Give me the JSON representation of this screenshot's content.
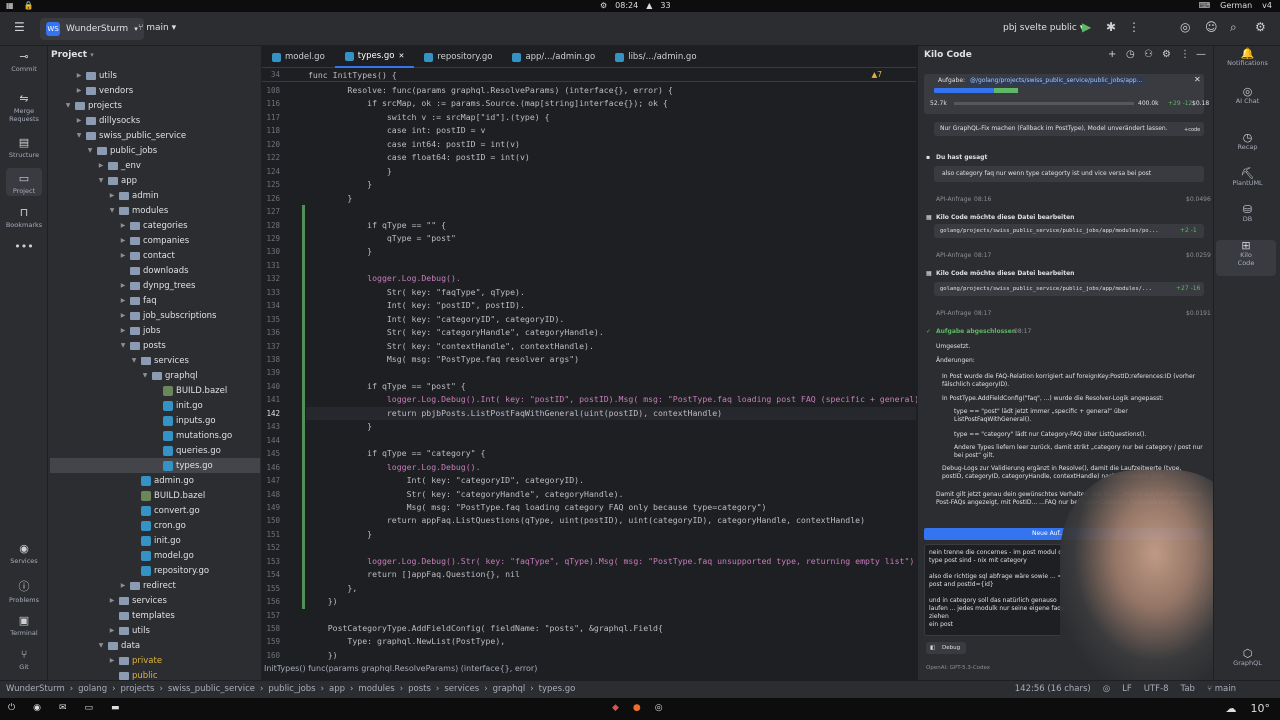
{
  "os": {
    "time": "08:24",
    "counter": "33",
    "lang": "German",
    "layout": "v4"
  },
  "title": {
    "project": "WunderSturm",
    "project_badge": "WS",
    "branch": "main",
    "run_config": "pbj svelte public"
  },
  "left_strip": [
    "Commit",
    "Merge Requests",
    "Structure",
    "Project",
    "Bookmarks",
    "Services",
    "Problems",
    "Terminal",
    "Git"
  ],
  "project_panel": {
    "title": "Project",
    "rows": [
      {
        "label": "utils",
        "depth": 3,
        "kind": "folder",
        "arrow": "▶"
      },
      {
        "label": "vendors",
        "depth": 3,
        "kind": "folder",
        "arrow": "▶"
      },
      {
        "label": "projects",
        "depth": 2,
        "kind": "folder",
        "arrow": "▼"
      },
      {
        "label": "dillysocks",
        "depth": 3,
        "kind": "folder",
        "arrow": "▶"
      },
      {
        "label": "swiss_public_service",
        "depth": 3,
        "kind": "folder",
        "arrow": "▼"
      },
      {
        "label": "public_jobs",
        "depth": 4,
        "kind": "folder",
        "arrow": "▼"
      },
      {
        "label": "_env",
        "depth": 5,
        "kind": "folder",
        "arrow": "▶"
      },
      {
        "label": "app",
        "depth": 5,
        "kind": "folder",
        "arrow": "▼"
      },
      {
        "label": "admin",
        "depth": 6,
        "kind": "folder",
        "arrow": "▶"
      },
      {
        "label": "modules",
        "depth": 6,
        "kind": "folder",
        "arrow": "▼"
      },
      {
        "label": "categories",
        "depth": 7,
        "kind": "folder",
        "arrow": "▶"
      },
      {
        "label": "companies",
        "depth": 7,
        "kind": "folder",
        "arrow": "▶"
      },
      {
        "label": "contact",
        "depth": 7,
        "kind": "folder",
        "arrow": "▶"
      },
      {
        "label": "downloads",
        "depth": 7,
        "kind": "folder",
        "arrow": ""
      },
      {
        "label": "dynpg_trees",
        "depth": 7,
        "kind": "folder",
        "arrow": "▶"
      },
      {
        "label": "faq",
        "depth": 7,
        "kind": "folder",
        "arrow": "▶"
      },
      {
        "label": "job_subscriptions",
        "depth": 7,
        "kind": "folder",
        "arrow": "▶"
      },
      {
        "label": "jobs",
        "depth": 7,
        "kind": "folder",
        "arrow": "▶"
      },
      {
        "label": "posts",
        "depth": 7,
        "kind": "folder",
        "arrow": "▼"
      },
      {
        "label": "services",
        "depth": 8,
        "kind": "folder",
        "arrow": "▼"
      },
      {
        "label": "graphql",
        "depth": 9,
        "kind": "folder",
        "arrow": "▼"
      },
      {
        "label": "BUILD.bazel",
        "depth": 10,
        "kind": "bazel",
        "arrow": ""
      },
      {
        "label": "init.go",
        "depth": 10,
        "kind": "go",
        "arrow": ""
      },
      {
        "label": "inputs.go",
        "depth": 10,
        "kind": "go",
        "arrow": ""
      },
      {
        "label": "mutations.go",
        "depth": 10,
        "kind": "go",
        "arrow": ""
      },
      {
        "label": "queries.go",
        "depth": 10,
        "kind": "go",
        "arrow": ""
      },
      {
        "label": "types.go",
        "depth": 10,
        "kind": "go",
        "arrow": "",
        "selected": true
      },
      {
        "label": "admin.go",
        "depth": 8,
        "kind": "go",
        "arrow": ""
      },
      {
        "label": "BUILD.bazel",
        "depth": 8,
        "kind": "bazel",
        "arrow": ""
      },
      {
        "label": "convert.go",
        "depth": 8,
        "kind": "go",
        "arrow": ""
      },
      {
        "label": "cron.go",
        "depth": 8,
        "kind": "go",
        "arrow": ""
      },
      {
        "label": "init.go",
        "depth": 8,
        "kind": "go",
        "arrow": ""
      },
      {
        "label": "model.go",
        "depth": 8,
        "kind": "go",
        "arrow": ""
      },
      {
        "label": "repository.go",
        "depth": 8,
        "kind": "go",
        "arrow": ""
      },
      {
        "label": "redirect",
        "depth": 7,
        "kind": "folder",
        "arrow": "▶"
      },
      {
        "label": "services",
        "depth": 6,
        "kind": "folder",
        "arrow": "▶"
      },
      {
        "label": "templates",
        "depth": 6,
        "kind": "folder",
        "arrow": ""
      },
      {
        "label": "utils",
        "depth": 6,
        "kind": "folder",
        "arrow": "▶"
      },
      {
        "label": "data",
        "depth": 5,
        "kind": "folder",
        "arrow": "▼"
      },
      {
        "label": "private",
        "depth": 6,
        "kind": "folder",
        "arrow": "▶"
      },
      {
        "label": "public",
        "depth": 6,
        "kind": "folder",
        "arrow": ""
      }
    ]
  },
  "tabs": [
    {
      "label": "model.go",
      "active": false
    },
    {
      "label": "types.go",
      "active": true
    },
    {
      "label": "repository.go",
      "active": false
    },
    {
      "label": "app/.../admin.go",
      "active": false
    },
    {
      "label": "libs/.../admin.go",
      "active": false
    }
  ],
  "editor": {
    "sticky_num": "34",
    "sticky_line": "func InitTypes() {",
    "warn": "▲7",
    "lines": [
      {
        "n": "108",
        "t": "        Resolve: func(params graphql.ResolveParams) (interface{}, error) {"
      },
      {
        "n": "116",
        "t": "            if srcMap, ok := params.Source.(map[string]interface{}); ok {"
      },
      {
        "n": "117",
        "t": "                switch v := srcMap[\"id\"].(type) {"
      },
      {
        "n": "118",
        "t": "                case int: postID = v"
      },
      {
        "n": "120",
        "t": "                case int64: postID = int(v)"
      },
      {
        "n": "122",
        "t": "                case float64: postID = int(v)"
      },
      {
        "n": "124",
        "t": "                }"
      },
      {
        "n": "125",
        "t": "            }"
      },
      {
        "n": "126",
        "t": "        }"
      },
      {
        "n": "127",
        "t": ""
      },
      {
        "n": "128",
        "t": "            if qType == \"\" {"
      },
      {
        "n": "129",
        "t": "                qType = \"post\""
      },
      {
        "n": "130",
        "t": "            }"
      },
      {
        "n": "131",
        "t": ""
      },
      {
        "n": "132",
        "t": "            logger.Log.Debug()."
      },
      {
        "n": "133",
        "t": "                Str( key: \"faqType\", qType)."
      },
      {
        "n": "134",
        "t": "                Int( key: \"postID\", postID)."
      },
      {
        "n": "135",
        "t": "                Int( key: \"categoryID\", categoryID)."
      },
      {
        "n": "136",
        "t": "                Str( key: \"categoryHandle\", categoryHandle)."
      },
      {
        "n": "137",
        "t": "                Str( key: \"contextHandle\", contextHandle)."
      },
      {
        "n": "138",
        "t": "                Msg( msg: \"PostType.faq resolver args\")"
      },
      {
        "n": "139",
        "t": ""
      },
      {
        "n": "140",
        "t": "            if qType == \"post\" {"
      },
      {
        "n": "141",
        "t": "                logger.Log.Debug().Int( key: \"postID\", postID).Msg( msg: \"PostType.faq loading post FAQ (specific + general)\")"
      },
      {
        "n": "142",
        "t": "                return pbjbPosts.ListPostFaqWithGeneral(uint(postID), contextHandle)"
      },
      {
        "n": "143",
        "t": "            }"
      },
      {
        "n": "144",
        "t": ""
      },
      {
        "n": "145",
        "t": "            if qType == \"category\" {"
      },
      {
        "n": "146",
        "t": "                logger.Log.Debug()."
      },
      {
        "n": "147",
        "t": "                    Int( key: \"categoryID\", categoryID)."
      },
      {
        "n": "148",
        "t": "                    Str( key: \"categoryHandle\", categoryHandle)."
      },
      {
        "n": "149",
        "t": "                    Msg( msg: \"PostType.faq loading category FAQ only because type=category\")"
      },
      {
        "n": "150",
        "t": "                return appFaq.ListQuestions(qType, uint(postID), uint(categoryID), categoryHandle, contextHandle)"
      },
      {
        "n": "151",
        "t": "            }"
      },
      {
        "n": "152",
        "t": ""
      },
      {
        "n": "153",
        "t": "            logger.Log.Debug().Str( key: \"faqType\", qType).Msg( msg: \"PostType.faq unsupported type, returning empty list\")"
      },
      {
        "n": "154",
        "t": "            return []appFaq.Question{}, nil"
      },
      {
        "n": "155",
        "t": "        },"
      },
      {
        "n": "156",
        "t": "    })"
      },
      {
        "n": "157",
        "t": ""
      },
      {
        "n": "158",
        "t": "    PostCategoryType.AddFieldConfig( fieldName: \"posts\", &graphql.Field{"
      },
      {
        "n": "159",
        "t": "        Type: graphql.NewList(PostType),"
      },
      {
        "n": "160",
        "t": "    })"
      }
    ],
    "footer": "InitTypes()   func(params graphql.ResolveParams) (interface{}, error)"
  },
  "kilo": {
    "title": "Kilo Code",
    "task_label": "Aufgabe:",
    "task_path": "@/golang/projects/swiss_public_service/public_jobs/app...",
    "ctx_left": "52.7k",
    "ctx_right": "400.0k",
    "diff": "+29 -12",
    "cost": "$0.18",
    "msg0": "Nur GraphQL-Fix machen (Fallback im PostType), Model unverändert lassen.",
    "msg0_tag": "+code",
    "you_said": "Du hast gesagt",
    "user_msg": "also category faq nur wenn type categorty ist und vice versa bei post",
    "api1": "API-Anfrage",
    "api1_time": "08:16",
    "api1_cost": "$0.0496",
    "edit_title": "Kilo Code möchte diese Datei bearbeiten",
    "edit1_path": "golang/projects/swiss_public_service/public_jobs/app/modules/po...",
    "edit1_diff": "+2 -1",
    "api2": "API-Anfrage",
    "api2_time": "08:17",
    "api2_cost": "$0.0259",
    "edit2_path": "golang/projects/swiss_public_service/public_jobs/app/modules/...",
    "edit2_diff": "+27 -16",
    "api3": "API-Anfrage",
    "api3_time": "08:17",
    "api3_cost": "$0.0191",
    "done": "Aufgabe abgeschlossen",
    "done_time": "08:17",
    "r1": "Umgesetzt.",
    "r2": "Änderungen:",
    "b1": "In Post wurde die FAQ-Relation korrigiert auf foreignKey:PostID;references:ID (vorher fälschlich categoryID).",
    "b2": "In PostType.AddFieldConfig(\"faq\", ...) wurde die Resolver-Logik angepasst:",
    "b2a": "type == \"post\" lädt jetzt immer „specific + general“ über ListPostFaqWithGeneral().",
    "b2b": "type == \"category\" lädt nur Category-FAQ über ListQuestions().",
    "b2c": "Andere Types liefern leer zurück, damit strikt „category nur bei category / post nur bei post“ gilt.",
    "b3": "Debug-Logs zur Validierung ergänzt in Resolve(), damit die Laufzeitwerte (type, postID, categoryID, categoryHandle, contextHandle) nachvollziehbar sind.",
    "r3": "Damit gilt jetzt genau dein gewünschtes Verhalten: Bei Po... ...PostID werden allgemeine Post-FAQs angezeigt, mit PostID... ...FAQ nur bei type=category, Post-FAQ nur bei ...",
    "new_task": "Neue Auf...",
    "in1": "nein trenne die concernes - im post modul d... type post sind - nix mit category",
    "in2": "also die richtige sql abfrage wäre sowie ... = post and postId={id}",
    "in3": "und in category soll das natürlich genauso laufen ... jedes modulk nur seine eigene faqs ziehen",
    "in4": "ein post",
    "mode": "Debug",
    "model": "OpenAI: GPT-5.3-Codex"
  },
  "right_strip": [
    "Notifications",
    "AI Chat",
    "Recap",
    "PlantUML",
    "DB",
    "Kilo Code",
    "GraphQL"
  ],
  "status": {
    "crumbs": [
      "WunderSturm",
      "golang",
      "projects",
      "swiss_public_service",
      "public_jobs",
      "app",
      "modules",
      "posts",
      "services",
      "graphql",
      "types.go"
    ],
    "pos": "142:56 (16 chars)",
    "eol": "LF",
    "enc": "UTF-8",
    "indent": "Tab",
    "branch": "main"
  },
  "taskbar": {
    "weather": "10°"
  }
}
